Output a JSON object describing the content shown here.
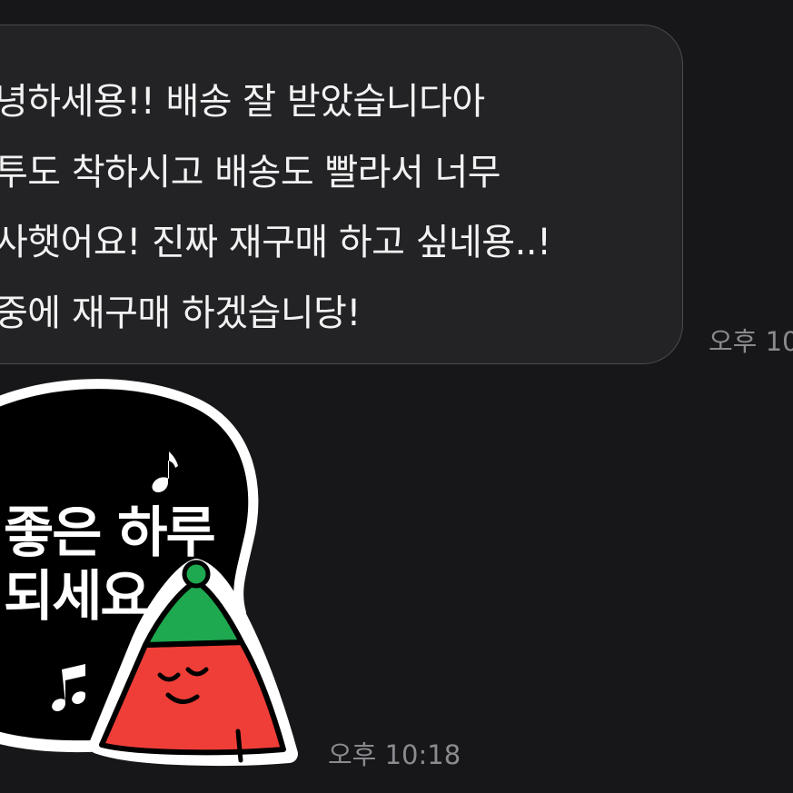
{
  "message": {
    "lines": [
      "녕하세용!! 배송 잘 받았습니다아",
      "투도 착하시고 배송도 빨라서 너무",
      "사햇어요! 진짜 재구매 하고 싶네용..!",
      "중에 재구매 하겠습니당!"
    ],
    "timestamp": "오후 10"
  },
  "sticker": {
    "line1": "좋은 하루",
    "line2": "되세요",
    "timestamp": "오후 10:18",
    "colors": {
      "bubble": "#000000",
      "outline": "#ffffff",
      "hat": "#1ea84f",
      "body": "#ef3e38"
    }
  }
}
